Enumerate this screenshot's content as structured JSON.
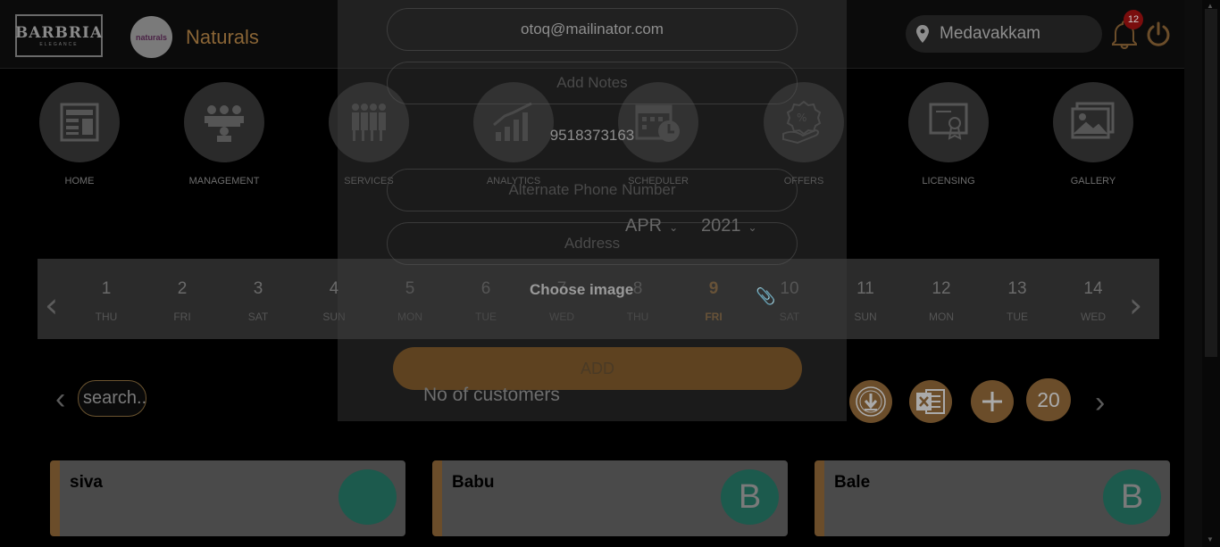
{
  "header": {
    "logo_text": "BARBRIA",
    "logo_sub": "ELEGANCE",
    "brand_avatar_text": "naturals",
    "brand_name": "Naturals",
    "location": "Medavakkam",
    "notification_count": "12"
  },
  "nav": [
    {
      "label": "HOME",
      "icon": "home-icon"
    },
    {
      "label": "MANAGEMENT",
      "icon": "management-icon"
    },
    {
      "label": "SERVICES",
      "icon": "services-icon"
    },
    {
      "label": "ANALYTICS",
      "icon": "analytics-icon"
    },
    {
      "label": "SCHEDULER",
      "icon": "scheduler-icon"
    },
    {
      "label": "OFFERS",
      "icon": "offers-icon"
    },
    {
      "label": "LICENSING",
      "icon": "licensing-icon"
    },
    {
      "label": "GALLERY",
      "icon": "gallery-icon"
    }
  ],
  "calendar": {
    "month": "APR",
    "year": "2021",
    "days": [
      {
        "num": "1",
        "dow": "THU"
      },
      {
        "num": "2",
        "dow": "FRI"
      },
      {
        "num": "3",
        "dow": "SAT"
      },
      {
        "num": "4",
        "dow": "SUN"
      },
      {
        "num": "5",
        "dow": "MON"
      },
      {
        "num": "6",
        "dow": "TUE"
      },
      {
        "num": "7",
        "dow": "WED"
      },
      {
        "num": "8",
        "dow": "THU"
      },
      {
        "num": "9",
        "dow": "FRI"
      },
      {
        "num": "10",
        "dow": "SAT"
      },
      {
        "num": "11",
        "dow": "SUN"
      },
      {
        "num": "12",
        "dow": "MON"
      },
      {
        "num": "13",
        "dow": "TUE"
      },
      {
        "num": "14",
        "dow": "WED"
      }
    ],
    "selected_day": "9"
  },
  "modal": {
    "email": "otoq@mailinator.com",
    "notes_placeholder": "Add Notes",
    "phone": "9518373163",
    "alt_phone_placeholder": "Alternate Phone Number",
    "address_placeholder": "Address",
    "choose_image": "Choose image",
    "add_button": "ADD"
  },
  "toolbar": {
    "search_placeholder": "search...",
    "customers_label": "No of customers",
    "customer_count": "20"
  },
  "customers": [
    {
      "name": "siva",
      "initial": ""
    },
    {
      "name": "Babu",
      "initial": "B"
    },
    {
      "name": "Bale",
      "initial": "B"
    }
  ],
  "colors": {
    "accent": "#8a6536",
    "avatar_teal": "#1c5a4d",
    "badge_red": "#7a0d0d"
  }
}
